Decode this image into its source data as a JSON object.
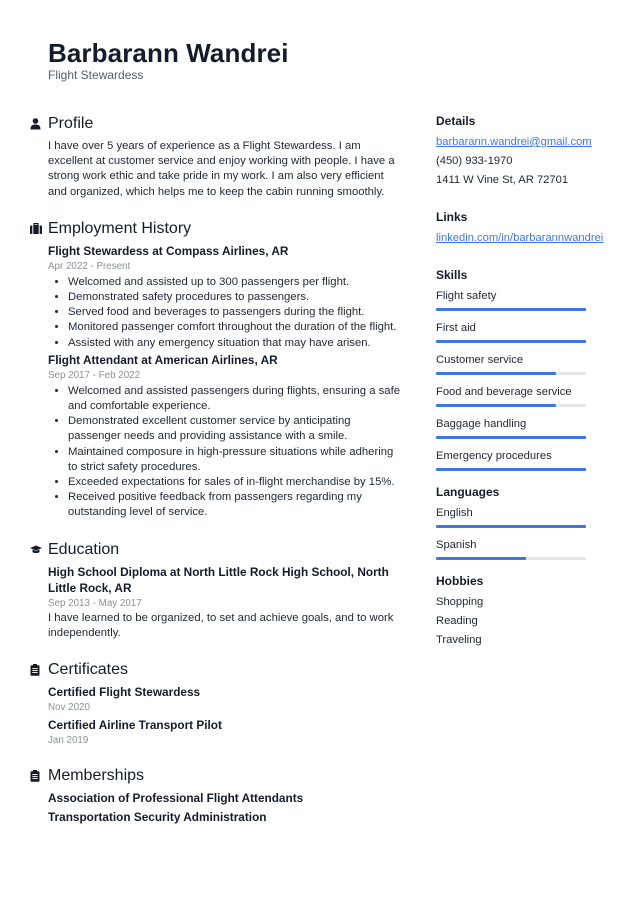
{
  "header": {
    "name": "Barbarann Wandrei",
    "title": "Flight Stewardess"
  },
  "sections": {
    "profile": {
      "title": "Profile",
      "icon": "person-icon",
      "text": "I have over 5 years of experience as a Flight Stewardess. I am excellent at customer service and enjoy working with people. I have a strong work ethic and take pride in my work. I am also very efficient and organized, which helps me to keep the cabin running smoothly."
    },
    "employment": {
      "title": "Employment History",
      "icon": "briefcase-icon",
      "jobs": [
        {
          "title": "Flight Stewardess at Compass Airlines, AR",
          "date": "Apr 2022 - Present",
          "bullets": [
            "Welcomed and assisted up to 300 passengers per flight.",
            "Demonstrated safety procedures to passengers.",
            "Served food and beverages to passengers during the flight.",
            "Monitored passenger comfort throughout the duration of the flight.",
            "Assisted with any emergency situation that may have arisen."
          ]
        },
        {
          "title": "Flight Attendant at American Airlines, AR",
          "date": "Sep 2017 - Feb 2022",
          "bullets": [
            "Welcomed and assisted passengers during flights, ensuring a safe and comfortable experience.",
            "Demonstrated excellent customer service by anticipating passenger needs and providing assistance with a smile.",
            "Maintained composure in high-pressure situations while adhering to strict safety procedures.",
            "Exceeded expectations for sales of in-flight merchandise by 15%.",
            "Received positive feedback from passengers regarding my outstanding level of service."
          ]
        }
      ]
    },
    "education": {
      "title": "Education",
      "icon": "graduation-cap-icon",
      "entries": [
        {
          "title": "High School Diploma at North Little Rock High School, North Little Rock, AR",
          "date": "Sep 2013 - May 2017",
          "text": "I have learned to be organized, to set and achieve goals, and to work independently."
        }
      ]
    },
    "certificates": {
      "title": "Certificates",
      "icon": "clipboard-icon",
      "entries": [
        {
          "title": "Certified Flight Stewardess",
          "date": "Nov 2020"
        },
        {
          "title": "Certified Airline Transport Pilot",
          "date": "Jan 2019"
        }
      ]
    },
    "memberships": {
      "title": "Memberships",
      "icon": "clipboard-icon",
      "items": [
        "Association of Professional Flight Attendants",
        "Transportation Security Administration"
      ]
    }
  },
  "sidebar": {
    "details": {
      "title": "Details",
      "email": "barbarann.wandrei@gmail.com",
      "phone": "(450) 933-1970",
      "address": "1411 W Vine St, AR 72701"
    },
    "links": {
      "title": "Links",
      "items": [
        "linkedin.com/in/barbarannwandrei"
      ]
    },
    "skills": {
      "title": "Skills",
      "items": [
        {
          "label": "Flight safety",
          "level": 1.0
        },
        {
          "label": "First aid",
          "level": 1.0
        },
        {
          "label": "Customer service",
          "level": 0.8
        },
        {
          "label": "Food and beverage service",
          "level": 0.8
        },
        {
          "label": "Baggage handling",
          "level": 1.0
        },
        {
          "label": "Emergency procedures",
          "level": 1.0
        }
      ]
    },
    "languages": {
      "title": "Languages",
      "items": [
        {
          "label": "English",
          "level": 1.0
        },
        {
          "label": "Spanish",
          "level": 0.6
        }
      ]
    },
    "hobbies": {
      "title": "Hobbies",
      "items": [
        "Shopping",
        "Reading",
        "Traveling"
      ]
    }
  },
  "colors": {
    "accent": "#3b78e7",
    "text": "#1a2233",
    "muted": "#8a909b",
    "bar_track": "#e4e6ea"
  }
}
